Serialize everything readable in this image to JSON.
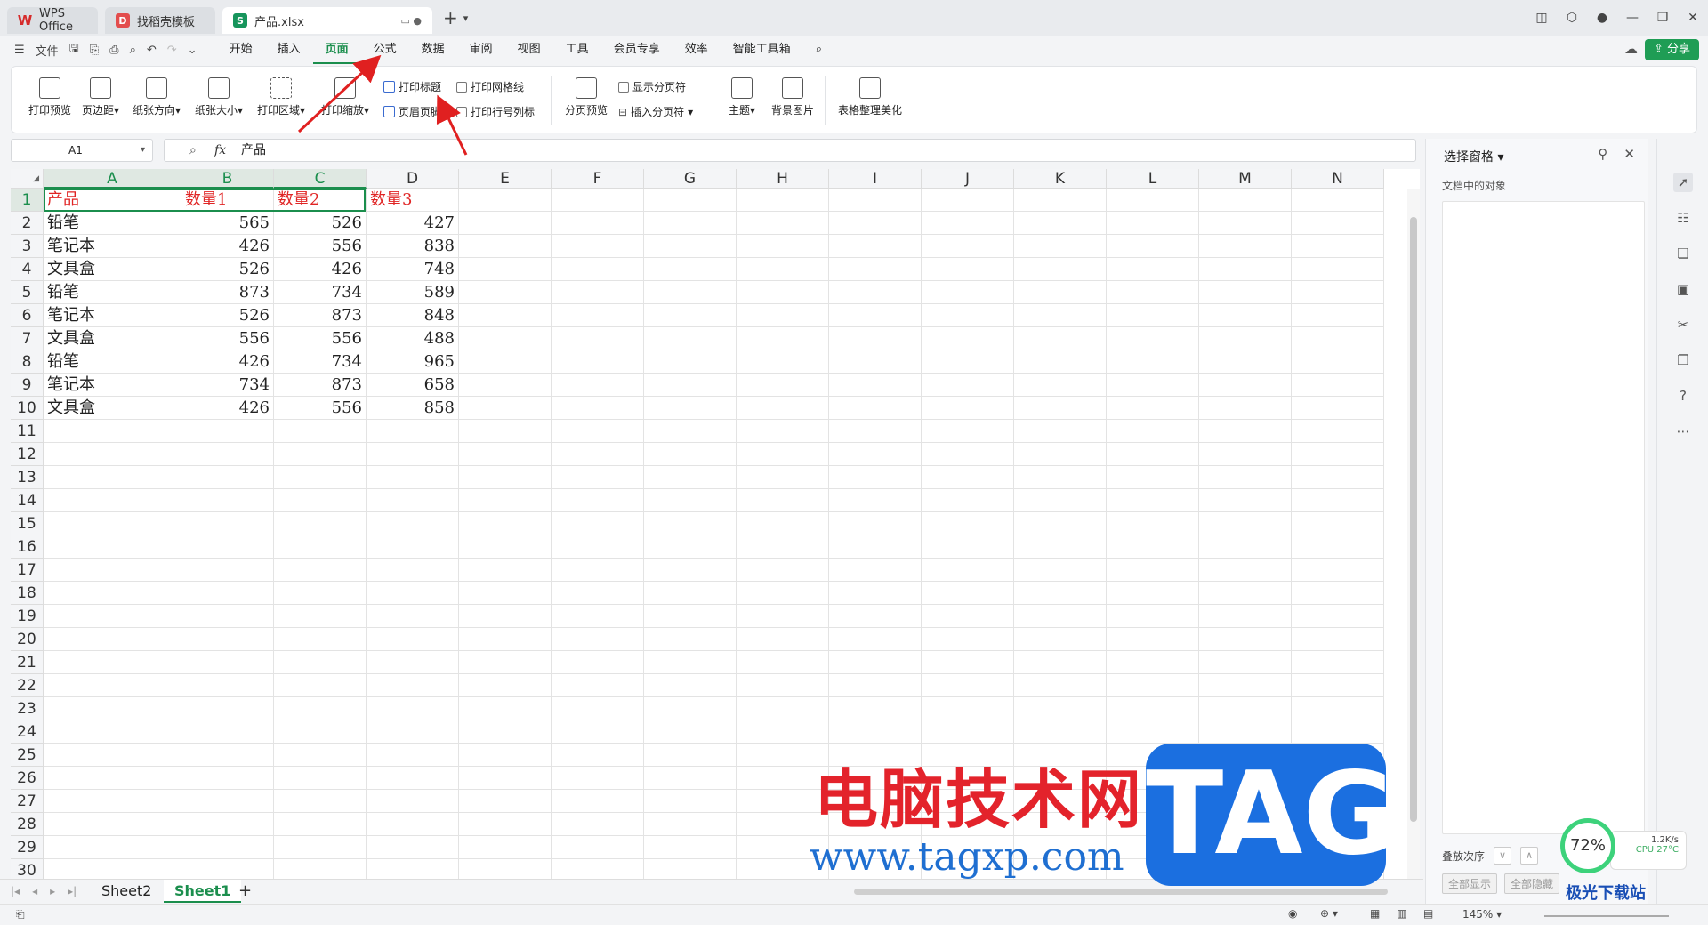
{
  "titlebar": {
    "tabs": [
      {
        "label": "WPS Office"
      },
      {
        "label": "找稻壳模板"
      },
      {
        "label": "产品.xlsx"
      }
    ]
  },
  "menu": {
    "file_label": "文件",
    "items": [
      "开始",
      "插入",
      "页面",
      "公式",
      "数据",
      "审阅",
      "视图",
      "工具",
      "会员专享",
      "效率",
      "智能工具箱"
    ],
    "active": "页面",
    "share_label": "分享"
  },
  "ribbon": {
    "print_preview": "打印预览",
    "margins": "页边距",
    "orientation": "纸张方向",
    "paper_size": "纸张大小",
    "print_area": "打印区域",
    "print_scale": "打印缩放",
    "print_titles": "打印标题",
    "header_footer": "页眉页脚",
    "print_gridlines": "打印网格线",
    "print_row_col_headers": "打印行号列标",
    "page_break_preview": "分页预览",
    "show_page_breaks": "显示分页符",
    "insert_page_break": "插入分页符",
    "theme": "主题",
    "background": "背景图片",
    "beautify": "表格整理美化"
  },
  "formula_bar": {
    "cell_ref": "A1",
    "content": "产品"
  },
  "grid": {
    "columns": [
      "A",
      "B",
      "C",
      "D",
      "E",
      "F",
      "G",
      "H",
      "I",
      "J",
      "K",
      "L",
      "M",
      "N"
    ],
    "row_numbers": [
      "1",
      "2",
      "3",
      "4",
      "5",
      "6",
      "7",
      "8",
      "9",
      "10",
      "11",
      "12",
      "13",
      "14",
      "15",
      "16",
      "17",
      "18",
      "19",
      "20",
      "21",
      "22",
      "23",
      "24",
      "25",
      "26",
      "27",
      "28",
      "29",
      "30"
    ],
    "header_row": [
      "产品",
      "数量1",
      "数量2",
      "数量3"
    ],
    "rows": [
      [
        "铅笔",
        "565",
        "526",
        "427"
      ],
      [
        "笔记本",
        "426",
        "556",
        "838"
      ],
      [
        "文具盒",
        "526",
        "426",
        "748"
      ],
      [
        "铅笔",
        "873",
        "734",
        "589"
      ],
      [
        "笔记本",
        "526",
        "873",
        "848"
      ],
      [
        "文具盒",
        "556",
        "556",
        "488"
      ],
      [
        "铅笔",
        "426",
        "734",
        "965"
      ],
      [
        "笔记本",
        "734",
        "873",
        "658"
      ],
      [
        "文具盒",
        "426",
        "556",
        "858"
      ]
    ]
  },
  "sheets": {
    "tabs": [
      "Sheet2",
      "Sheet1"
    ],
    "active": "Sheet1"
  },
  "status": {
    "zoom": "145%"
  },
  "selection_pane": {
    "title": "选择窗格",
    "subtitle": "文档中的对象",
    "stack_order": "叠放次序",
    "show_all": "全部显示",
    "hide_all": "全部隐藏"
  },
  "overlays": {
    "watermark_cn": "电脑技术网",
    "watermark_url": "www.tagxp.com",
    "watermark_tag": "TAG",
    "cpu_percent": "72%",
    "net_speed": "1.2K/s",
    "cpu_temp": "CPU 27°C",
    "corner_brand": "极光下载站"
  },
  "colors": {
    "accent": "#1b8e4d",
    "header_text": "#e02424",
    "arrow": "#e02020"
  }
}
